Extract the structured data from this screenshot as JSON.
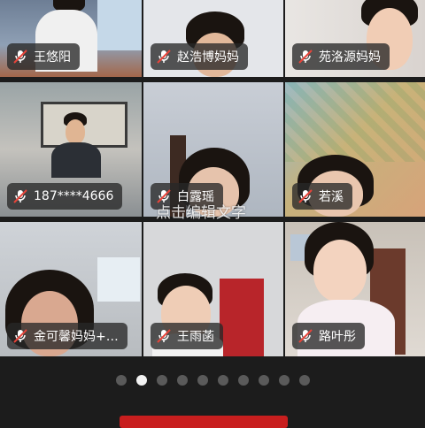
{
  "participants": [
    {
      "name": "王悠阳",
      "mic": "muted"
    },
    {
      "name": "赵浩博妈妈",
      "mic": "muted"
    },
    {
      "name": "苑洛源妈妈",
      "mic": "muted"
    },
    {
      "name": "187****4666",
      "mic": "muted"
    },
    {
      "name": "白露瑶",
      "mic": "muted"
    },
    {
      "name": "若溪",
      "mic": "muted"
    },
    {
      "name": "金可馨妈妈+…",
      "mic": "muted"
    },
    {
      "name": "王雨菡",
      "mic": "muted"
    },
    {
      "name": "路叶彤",
      "mic": "muted"
    }
  ],
  "overlay_text": "点击编辑文字",
  "pagination": {
    "total": 10,
    "current": 2
  },
  "colors": {
    "background": "#1c1c1c",
    "label_bg": "rgba(40,40,40,0.78)",
    "mic_muted": "#e8443a",
    "accent_bottom": "#c81e1e"
  }
}
